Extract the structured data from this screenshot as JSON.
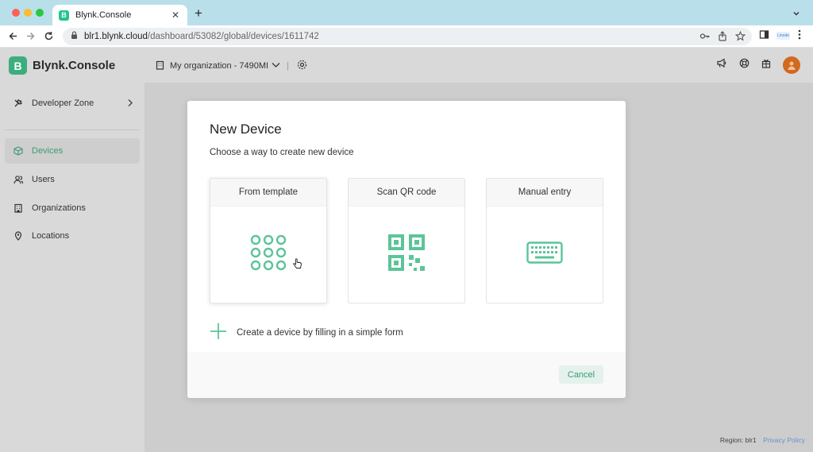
{
  "browser": {
    "tab_title": "Blynk.Console",
    "tab_favicon": "B",
    "url_host": "blr1.blynk.cloud",
    "url_path": "/dashboard/53082/global/devices/1611742",
    "extension_badge": "Linode"
  },
  "app": {
    "brand_letter": "B",
    "brand_name": "Blynk.Console",
    "accent_color": "#3cae7e"
  },
  "sidebar": {
    "developer_zone": "Developer Zone",
    "items": [
      {
        "label": "Devices",
        "icon": "cube-icon",
        "active": true
      },
      {
        "label": "Users",
        "icon": "users-icon"
      },
      {
        "label": "Organizations",
        "icon": "building-icon"
      },
      {
        "label": "Locations",
        "icon": "location-pin-icon"
      }
    ]
  },
  "header": {
    "org_name": "My organization - 7490MI",
    "separator": "|"
  },
  "modal": {
    "title": "New Device",
    "subtitle": "Choose a way to create new device",
    "options": [
      {
        "label": "From template",
        "icon": "template-grid-icon",
        "selected": true
      },
      {
        "label": "Scan QR code",
        "icon": "qr-code-icon"
      },
      {
        "label": "Manual entry",
        "icon": "keyboard-icon"
      }
    ],
    "simple_form": "Create a device by filling in a simple form",
    "cancel": "Cancel"
  },
  "footer": {
    "region": "Region: blr1",
    "privacy": "Privacy Policy"
  }
}
